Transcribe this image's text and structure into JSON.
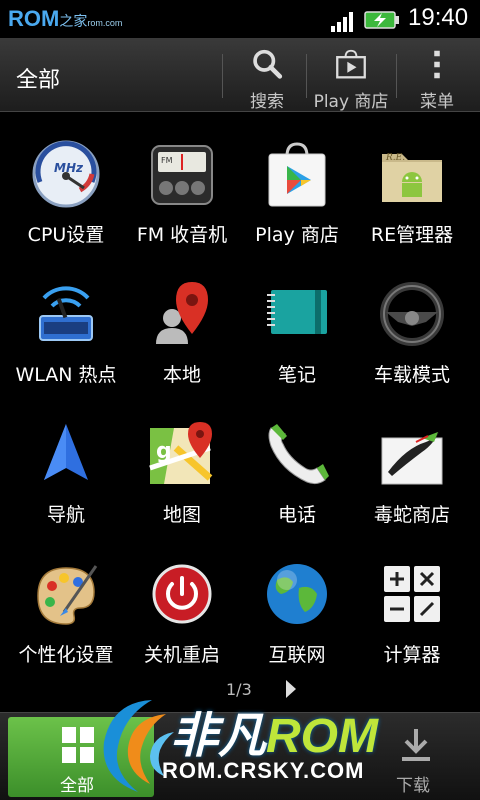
{
  "status_bar": {
    "watermark_rom": "ROM",
    "watermark_sub": "之家",
    "watermark_tiny": "rom.com",
    "time": "19:40"
  },
  "action_bar": {
    "title": "全部",
    "search_label": "搜索",
    "play_store_label": "Play 商店",
    "menu_label": "菜单"
  },
  "apps": [
    {
      "label": "CPU设置",
      "icon": "speedometer-icon"
    },
    {
      "label": "FM 收音机",
      "icon": "radio-icon"
    },
    {
      "label": "Play 商店",
      "icon": "play-store-icon"
    },
    {
      "label": "RE管理器",
      "icon": "folder-android-icon"
    },
    {
      "label": "WLAN 热点",
      "icon": "wifi-hotspot-icon"
    },
    {
      "label": "本地",
      "icon": "map-pin-person-icon"
    },
    {
      "label": "笔记",
      "icon": "notebook-icon"
    },
    {
      "label": "车载模式",
      "icon": "steering-wheel-icon"
    },
    {
      "label": "导航",
      "icon": "navigation-arrow-icon"
    },
    {
      "label": "地图",
      "icon": "maps-icon"
    },
    {
      "label": "电话",
      "icon": "phone-icon"
    },
    {
      "label": "毒蛇商店",
      "icon": "viper-store-icon"
    },
    {
      "label": "个性化设置",
      "icon": "palette-icon"
    },
    {
      "label": "关机重启",
      "icon": "power-icon"
    },
    {
      "label": "互联网",
      "icon": "globe-icon"
    },
    {
      "label": "计算器",
      "icon": "calculator-icon"
    }
  ],
  "pager": {
    "text": "1/3"
  },
  "bottom_bar": {
    "all_label": "全部",
    "download_label": "下载"
  },
  "watermark": {
    "title_cn": "非凡",
    "title_rom": "ROM",
    "url": "ROM.CRSKY.COM"
  },
  "colors": {
    "accent_green": "#6cc24a",
    "watermark_blue": "#4aa9ef",
    "watermark_lime": "#bfe63a"
  }
}
